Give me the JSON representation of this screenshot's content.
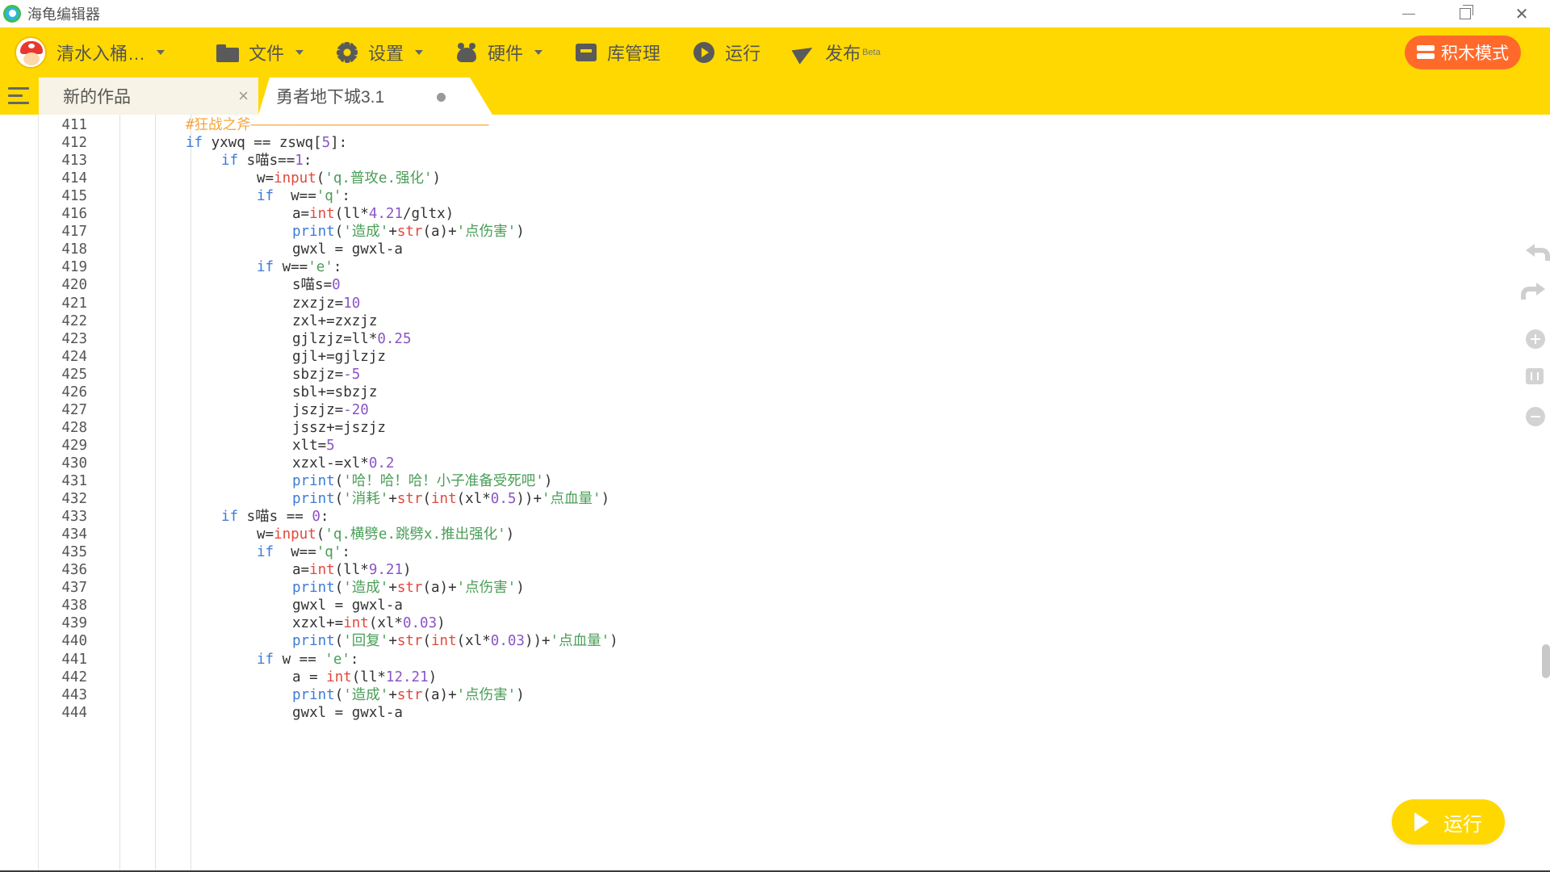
{
  "window": {
    "title": "海龟编辑器"
  },
  "toolbar": {
    "user_name": "清水入桶…",
    "menu": [
      {
        "label": "文件",
        "icon": "folder-icon",
        "has_caret": true
      },
      {
        "label": "设置",
        "icon": "gear-icon",
        "has_caret": true
      },
      {
        "label": "硬件",
        "icon": "hardware-icon",
        "has_caret": true
      },
      {
        "label": "库管理",
        "icon": "library-icon",
        "has_caret": false
      },
      {
        "label": "运行",
        "icon": "run-icon",
        "has_caret": false
      },
      {
        "label": "发布",
        "icon": "publish-icon",
        "has_caret": false,
        "badge": "Beta"
      }
    ],
    "block_mode_label": "积木模式"
  },
  "tabs": [
    {
      "label": "新的作品",
      "close": "×"
    },
    {
      "label": "勇者地下城3.1"
    }
  ],
  "run_button_label": "运行",
  "colors": {
    "accent": "#fed800",
    "block_mode": "#ff6a2b",
    "keyword": "#3c7bd6",
    "builtin": "#e3483c",
    "number": "#8a55c5",
    "string": "#4a9e57",
    "comment": "#f7a53a"
  },
  "code_lines": [
    {
      "n": "411",
      "indent": 0,
      "tokens": [
        [
          "cmt",
          "#狂战之斧————————————————————————————"
        ]
      ]
    },
    {
      "n": "412",
      "indent": 0,
      "tokens": [
        [
          "kw",
          "if"
        ],
        [
          "",
          " yxwq == zswq["
        ],
        [
          "num",
          "5"
        ],
        [
          "",
          "]:"
        ]
      ]
    },
    {
      "n": "413",
      "indent": 1,
      "tokens": [
        [
          "kw",
          "if"
        ],
        [
          "",
          " s喵s=="
        ],
        [
          "num",
          "1"
        ],
        [
          "",
          ":"
        ]
      ]
    },
    {
      "n": "414",
      "indent": 2,
      "tokens": [
        [
          "",
          "w="
        ],
        [
          "fn",
          "input"
        ],
        [
          "",
          "("
        ],
        [
          "str",
          "'q.普攻e.强化'"
        ],
        [
          "",
          ")"
        ]
      ]
    },
    {
      "n": "415",
      "indent": 2,
      "tokens": [
        [
          "kw",
          "if"
        ],
        [
          "",
          "  w=="
        ],
        [
          "str",
          "'q'"
        ],
        [
          "",
          ":"
        ]
      ]
    },
    {
      "n": "416",
      "indent": 3,
      "tokens": [
        [
          "",
          "a="
        ],
        [
          "fn",
          "int"
        ],
        [
          "",
          "(ll*"
        ],
        [
          "num",
          "4.21"
        ],
        [
          "",
          "/gltx)"
        ]
      ]
    },
    {
      "n": "417",
      "indent": 3,
      "tokens": [
        [
          "kw",
          "print"
        ],
        [
          "",
          "("
        ],
        [
          "str",
          "'造成'"
        ],
        [
          "",
          "+"
        ],
        [
          "fn",
          "str"
        ],
        [
          "",
          "(a)+"
        ],
        [
          "str",
          "'点伤害'"
        ],
        [
          "",
          ")"
        ]
      ]
    },
    {
      "n": "418",
      "indent": 3,
      "tokens": [
        [
          "",
          "gwxl = gwxl-a"
        ]
      ]
    },
    {
      "n": "419",
      "indent": 2,
      "tokens": [
        [
          "kw",
          "if"
        ],
        [
          "",
          " w=="
        ],
        [
          "str",
          "'e'"
        ],
        [
          "",
          ":"
        ]
      ]
    },
    {
      "n": "420",
      "indent": 3,
      "tokens": [
        [
          "",
          "s喵s="
        ],
        [
          "num",
          "0"
        ]
      ]
    },
    {
      "n": "421",
      "indent": 3,
      "tokens": [
        [
          "",
          "zxzjz="
        ],
        [
          "num",
          "10"
        ]
      ]
    },
    {
      "n": "422",
      "indent": 3,
      "tokens": [
        [
          "",
          "zxl+=zxzjz"
        ]
      ]
    },
    {
      "n": "423",
      "indent": 3,
      "tokens": [
        [
          "",
          "gjlzjz=ll*"
        ],
        [
          "num",
          "0.25"
        ]
      ]
    },
    {
      "n": "424",
      "indent": 3,
      "tokens": [
        [
          "",
          "gjl+=gjlzjz"
        ]
      ]
    },
    {
      "n": "425",
      "indent": 3,
      "tokens": [
        [
          "",
          "sbzjz="
        ],
        [
          "num",
          "-5"
        ]
      ]
    },
    {
      "n": "426",
      "indent": 3,
      "tokens": [
        [
          "",
          "sbl+=sbzjz"
        ]
      ]
    },
    {
      "n": "427",
      "indent": 3,
      "tokens": [
        [
          "",
          "jszjz="
        ],
        [
          "num",
          "-20"
        ]
      ]
    },
    {
      "n": "428",
      "indent": 3,
      "tokens": [
        [
          "",
          "jssz+=jszjz"
        ]
      ]
    },
    {
      "n": "429",
      "indent": 3,
      "tokens": [
        [
          "",
          "xlt="
        ],
        [
          "num",
          "5"
        ]
      ]
    },
    {
      "n": "430",
      "indent": 3,
      "tokens": [
        [
          "",
          "xzxl-=xl*"
        ],
        [
          "num",
          "0.2"
        ]
      ]
    },
    {
      "n": "431",
      "indent": 3,
      "tokens": [
        [
          "kw",
          "print"
        ],
        [
          "",
          "("
        ],
        [
          "str",
          "'哈！哈！哈！小子准备受死吧'"
        ],
        [
          "",
          ")"
        ]
      ]
    },
    {
      "n": "432",
      "indent": 3,
      "tokens": [
        [
          "kw",
          "print"
        ],
        [
          "",
          "("
        ],
        [
          "str",
          "'消耗'"
        ],
        [
          "",
          "+"
        ],
        [
          "fn",
          "str"
        ],
        [
          "",
          "("
        ],
        [
          "fn",
          "int"
        ],
        [
          "",
          "(xl*"
        ],
        [
          "num",
          "0.5"
        ],
        [
          "",
          "))+"
        ],
        [
          "str",
          "'点血量'"
        ],
        [
          "",
          ")"
        ]
      ]
    },
    {
      "n": "433",
      "indent": 1,
      "tokens": [
        [
          "kw",
          "if"
        ],
        [
          "",
          " s喵s == "
        ],
        [
          "num",
          "0"
        ],
        [
          "",
          ":"
        ]
      ]
    },
    {
      "n": "434",
      "indent": 2,
      "tokens": [
        [
          "",
          "w="
        ],
        [
          "fn",
          "input"
        ],
        [
          "",
          "("
        ],
        [
          "str",
          "'q.横劈e.跳劈x.推出强化'"
        ],
        [
          "",
          ")"
        ]
      ]
    },
    {
      "n": "435",
      "indent": 2,
      "tokens": [
        [
          "kw",
          "if"
        ],
        [
          "",
          "  w=="
        ],
        [
          "str",
          "'q'"
        ],
        [
          "",
          ":"
        ]
      ]
    },
    {
      "n": "436",
      "indent": 3,
      "tokens": [
        [
          "",
          "a="
        ],
        [
          "fn",
          "int"
        ],
        [
          "",
          "(ll*"
        ],
        [
          "num",
          "9.21"
        ],
        [
          "",
          ")"
        ]
      ]
    },
    {
      "n": "437",
      "indent": 3,
      "tokens": [
        [
          "kw",
          "print"
        ],
        [
          "",
          "("
        ],
        [
          "str",
          "'造成'"
        ],
        [
          "",
          "+"
        ],
        [
          "fn",
          "str"
        ],
        [
          "",
          "(a)+"
        ],
        [
          "str",
          "'点伤害'"
        ],
        [
          "",
          ")"
        ]
      ]
    },
    {
      "n": "438",
      "indent": 3,
      "tokens": [
        [
          "",
          "gwxl = gwxl-a"
        ]
      ]
    },
    {
      "n": "439",
      "indent": 3,
      "tokens": [
        [
          "",
          "xzxl+="
        ],
        [
          "fn",
          "int"
        ],
        [
          "",
          "(xl*"
        ],
        [
          "num",
          "0.03"
        ],
        [
          "",
          ")"
        ]
      ]
    },
    {
      "n": "440",
      "indent": 3,
      "tokens": [
        [
          "kw",
          "print"
        ],
        [
          "",
          "("
        ],
        [
          "str",
          "'回复'"
        ],
        [
          "",
          "+"
        ],
        [
          "fn",
          "str"
        ],
        [
          "",
          "("
        ],
        [
          "fn",
          "int"
        ],
        [
          "",
          "(xl*"
        ],
        [
          "num",
          "0.03"
        ],
        [
          "",
          "))+"
        ],
        [
          "str",
          "'点血量'"
        ],
        [
          "",
          ")"
        ]
      ]
    },
    {
      "n": "441",
      "indent": 2,
      "tokens": [
        [
          "kw",
          "if"
        ],
        [
          "",
          " w == "
        ],
        [
          "str",
          "'e'"
        ],
        [
          "",
          ":"
        ]
      ]
    },
    {
      "n": "442",
      "indent": 3,
      "tokens": [
        [
          "",
          "a = "
        ],
        [
          "fn",
          "int"
        ],
        [
          "",
          "(ll*"
        ],
        [
          "num",
          "12.21"
        ],
        [
          "",
          ")"
        ]
      ]
    },
    {
      "n": "443",
      "indent": 3,
      "tokens": [
        [
          "kw",
          "print"
        ],
        [
          "",
          "("
        ],
        [
          "str",
          "'造成'"
        ],
        [
          "",
          "+"
        ],
        [
          "fn",
          "str"
        ],
        [
          "",
          "(a)+"
        ],
        [
          "str",
          "'点伤害'"
        ],
        [
          "",
          ")"
        ]
      ]
    },
    {
      "n": "444",
      "indent": 3,
      "tokens": [
        [
          "",
          "gwxl = gwxl-a"
        ]
      ]
    }
  ]
}
